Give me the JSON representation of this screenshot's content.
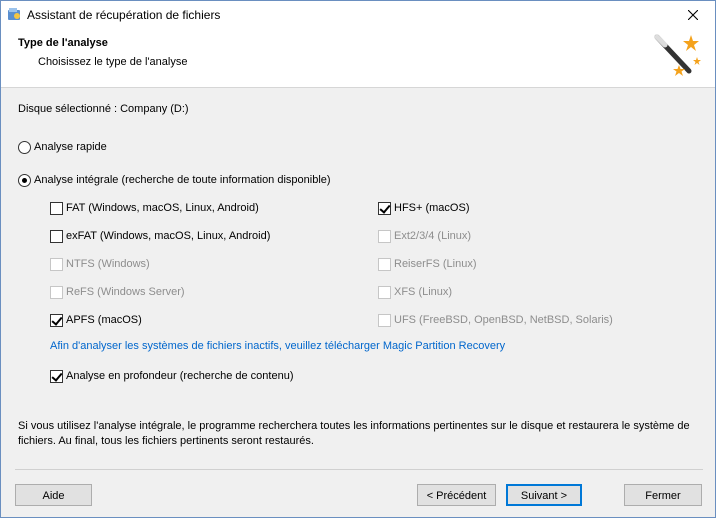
{
  "window": {
    "title": "Assistant de récupération de fichiers"
  },
  "header": {
    "title": "Type de l'analyse",
    "subtitle": "Choisissez le type de l'analyse"
  },
  "disk": {
    "label": "Disque sélectionné : Company (D:)"
  },
  "scan_modes": [
    {
      "label": "Analyse rapide",
      "checked": false
    },
    {
      "label": "Analyse intégrale (recherche de toute information disponible)",
      "checked": true
    }
  ],
  "filesystems": {
    "left": [
      {
        "label": "FAT (Windows, macOS, Linux, Android)",
        "checked": false,
        "enabled": true
      },
      {
        "label": "exFAT (Windows, macOS, Linux, Android)",
        "checked": false,
        "enabled": true
      },
      {
        "label": "NTFS (Windows)",
        "checked": false,
        "enabled": false
      },
      {
        "label": "ReFS (Windows Server)",
        "checked": false,
        "enabled": false
      },
      {
        "label": "APFS (macOS)",
        "checked": true,
        "enabled": true
      }
    ],
    "right": [
      {
        "label": "HFS+ (macOS)",
        "checked": true,
        "enabled": true
      },
      {
        "label": "Ext2/3/4 (Linux)",
        "checked": false,
        "enabled": false
      },
      {
        "label": "ReiserFS (Linux)",
        "checked": false,
        "enabled": false
      },
      {
        "label": "XFS (Linux)",
        "checked": false,
        "enabled": false
      },
      {
        "label": "UFS (FreeBSD, OpenBSD, NetBSD, Solaris)",
        "checked": false,
        "enabled": false
      }
    ]
  },
  "link_text": "Afin d'analyser les systèmes de fichiers inactifs, veuillez télécharger Magic Partition Recovery",
  "deep_scan": {
    "label": "Analyse en profondeur (recherche de contenu)",
    "checked": true
  },
  "info": "Si vous utilisez l'analyse intégrale, le programme recherchera toutes les informations pertinentes sur le disque et restaurera le système de fichiers. Au final, tous les fichiers pertinents seront restaurés.",
  "buttons": {
    "help": "Aide",
    "previous": "< Précédent",
    "next": "Suivant >",
    "close": "Fermer"
  },
  "colors": {
    "link": "#0066cc",
    "accent": "#0078d7",
    "disabled_text": "#8d8d8d"
  }
}
